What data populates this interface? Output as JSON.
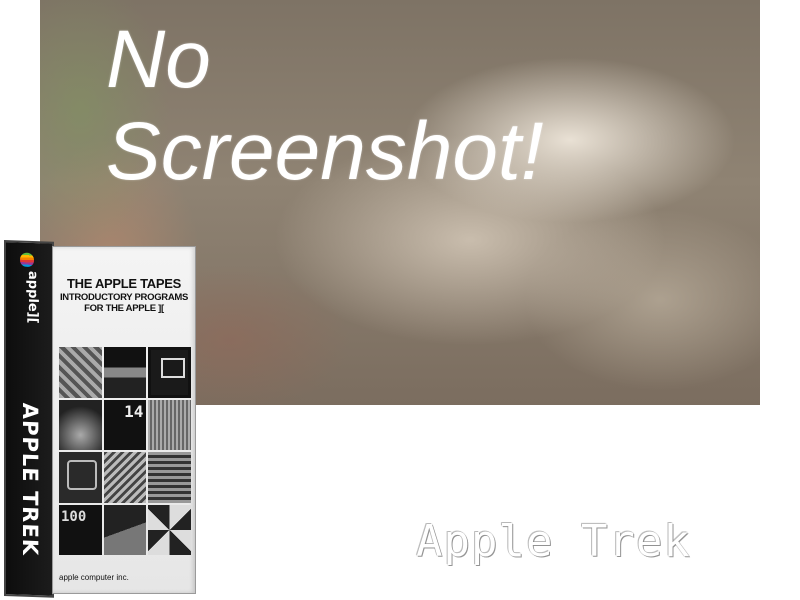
{
  "banner": {
    "title_line1": "No",
    "title_line2": "Screenshot!"
  },
  "boxart": {
    "spine_brand": "apple][",
    "spine_title": "APPLE TREK",
    "front_title": "THE APPLE TAPES",
    "front_subtitle_line1": "INTRODUCTORY PROGRAMS",
    "front_subtitle_line2": "FOR THE APPLE ][",
    "publisher": "apple computer inc."
  },
  "footer": {
    "logo_text": "Apple Trek"
  }
}
